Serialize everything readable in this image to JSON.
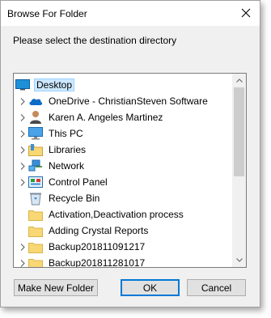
{
  "window": {
    "title": "Browse For Folder",
    "close_glyph": "✕"
  },
  "prompt": "Please select the destination directory",
  "tree": {
    "items": [
      {
        "label": "Desktop",
        "icon": "desktop-icon",
        "expandable": false,
        "selected": true,
        "indent": 0
      },
      {
        "label": "OneDrive - ChristianSteven Software",
        "icon": "onedrive-cloud-icon",
        "expandable": true,
        "selected": false,
        "indent": 1
      },
      {
        "label": "Karen A. Angeles Martinez",
        "icon": "user-folder-icon",
        "expandable": true,
        "selected": false,
        "indent": 1
      },
      {
        "label": "This PC",
        "icon": "computer-icon",
        "expandable": true,
        "selected": false,
        "indent": 1
      },
      {
        "label": "Libraries",
        "icon": "libraries-icon",
        "expandable": true,
        "selected": false,
        "indent": 1
      },
      {
        "label": "Network",
        "icon": "network-icon",
        "expandable": true,
        "selected": false,
        "indent": 1
      },
      {
        "label": "Control Panel",
        "icon": "control-panel-icon",
        "expandable": true,
        "selected": false,
        "indent": 1
      },
      {
        "label": "Recycle Bin",
        "icon": "recycle-bin-icon",
        "expandable": false,
        "selected": false,
        "indent": 1
      },
      {
        "label": "Activation,Deactivation process",
        "icon": "folder-icon",
        "expandable": false,
        "selected": false,
        "indent": 1
      },
      {
        "label": "Adding Crystal Reports",
        "icon": "folder-icon",
        "expandable": false,
        "selected": false,
        "indent": 1
      },
      {
        "label": "Backup201811091217",
        "icon": "folder-icon",
        "expandable": true,
        "selected": false,
        "indent": 1
      },
      {
        "label": "Backup201811281017",
        "icon": "folder-icon",
        "expandable": true,
        "selected": false,
        "indent": 1
      }
    ]
  },
  "buttons": {
    "make_new_folder": "Make New Folder",
    "ok": "OK",
    "cancel": "Cancel"
  },
  "colors": {
    "selection_bg": "#cce8ff",
    "folder": "#f8d775",
    "accent": "#0078d7"
  }
}
